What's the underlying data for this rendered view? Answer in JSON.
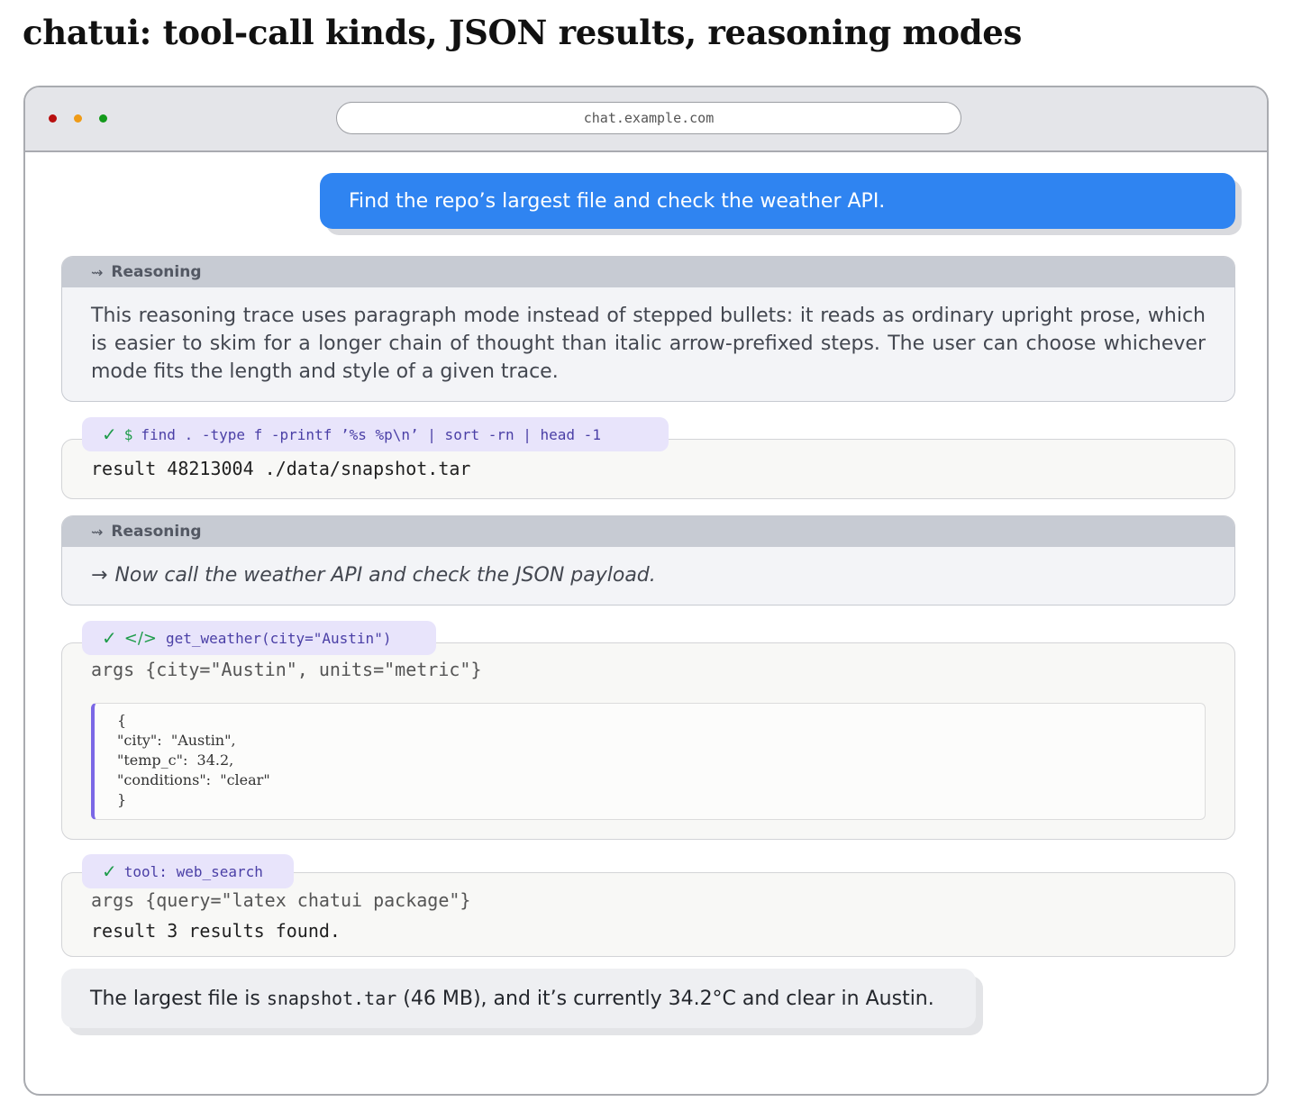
{
  "page_title": "chatui: tool-call kinds, JSON results, reasoning modes",
  "window": {
    "url": "chat.example.com",
    "traffic_lights": {
      "close": "#b80f0f",
      "minimize": "#ef9b17",
      "maximize": "#139a1b"
    }
  },
  "chat": {
    "user_message": "Find the repo’s largest file and check the weather API.",
    "reasoning_1": {
      "label": "Reasoning",
      "icon": "⇝",
      "text": "This reasoning trace uses paragraph mode instead of stepped bullets: it reads as ordinary upright prose, which is easier to skim for a longer chain of thought than italic arrow-prefixed steps. The user can choose whichever mode fits the length and style of a given trace."
    },
    "tool_1": {
      "status_icon": "✓",
      "prefix": "$",
      "command": "find . -type f -printf ’%s %p\\n’ | sort -rn | head -1",
      "result_label": "result",
      "result": "48213004 ./data/snapshot.tar"
    },
    "reasoning_2": {
      "label": "Reasoning",
      "icon": "⇝",
      "arrow": "→",
      "step": "Now call the weather API and check the JSON payload."
    },
    "tool_2": {
      "status_icon": "✓",
      "prefix": "</>",
      "call": "get_weather(city=\"Austin\")",
      "args_label": "args",
      "args": "{city=\"Austin\", units=\"metric\"}",
      "json_result": "{\n\"city\":  \"Austin\",\n\"temp_c\":  34.2,\n\"conditions\":  \"clear\"\n}"
    },
    "tool_3": {
      "status_icon": "✓",
      "call": "tool: web_search",
      "args_label": "args",
      "args": "{query=\"latex chatui package\"}",
      "result_label": "result",
      "result": "3 results found."
    },
    "assistant_message": {
      "before": "The largest file is ",
      "file": "snapshot.tar",
      "after": " (46 MB), and it’s currently 34.2°C and clear in Austin."
    }
  }
}
